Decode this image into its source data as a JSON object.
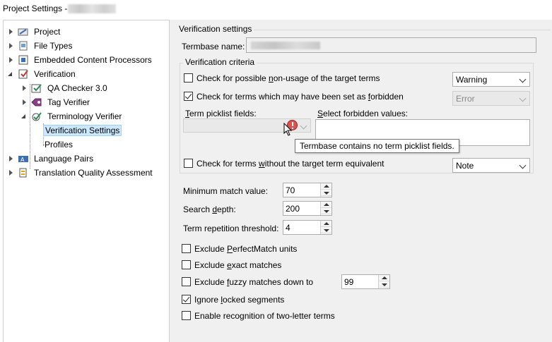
{
  "window": {
    "title": "Project Settings - "
  },
  "tree": {
    "items": [
      {
        "label": "Project"
      },
      {
        "label": "File Types"
      },
      {
        "label": "Embedded Content Processors"
      },
      {
        "label": "Verification"
      },
      {
        "label": "QA Checker 3.0"
      },
      {
        "label": "Tag Verifier"
      },
      {
        "label": "Terminology Verifier"
      },
      {
        "label": "Verification Settings"
      },
      {
        "label": "Profiles"
      },
      {
        "label": "Language Pairs"
      },
      {
        "label": "Translation Quality Assessment"
      }
    ]
  },
  "settings": {
    "section_title": "Verification settings",
    "termbase_label": "Termbase name:",
    "criteria": {
      "title": "Verification criteria",
      "nonusage": {
        "pre": "Check for possible ",
        "ul": "n",
        "post": "on-usage of the target terms",
        "checked": false,
        "severity": "Warning"
      },
      "forbidden": {
        "pre": "Check for terms which may have been set as ",
        "ul": "f",
        "post": "orbidden",
        "checked": true,
        "severity": "Error"
      },
      "picklist_label": {
        "pre": "",
        "ul": "T",
        "post": "erm picklist fields:"
      },
      "forbidden_values_label": {
        "pre": "",
        "ul": "S",
        "post": "elect forbidden values:"
      },
      "tooltip": "Termbase contains no term picklist fields.",
      "without": {
        "pre": "Check for terms ",
        "ul": "w",
        "post": "ithout the target term equivalent",
        "checked": false,
        "severity": "Note"
      }
    },
    "min_match": {
      "label": "Minimum match value:",
      "value": "70"
    },
    "search_depth": {
      "pre": "Search ",
      "ul": "d",
      "post": "epth:",
      "value": "200"
    },
    "repetition": {
      "label": "Term repetition threshold:",
      "value": "4"
    },
    "options": [
      {
        "pre": "Exclude ",
        "ul": "P",
        "post": "erfectMatch units",
        "checked": false
      },
      {
        "pre": "Exclude ",
        "ul": "e",
        "post": "xact matches",
        "checked": false
      },
      {
        "pre": "Exclude ",
        "ul": "f",
        "post": "uzzy matches down to",
        "checked": false,
        "value": "99"
      },
      {
        "pre": "Ignore ",
        "ul": "l",
        "post": "ocked segments",
        "checked": true
      },
      {
        "pre": "Enable recognition of two-letter terms",
        "ul": "",
        "post": "",
        "checked": false
      }
    ]
  },
  "colors": {
    "selection_bg": "#cce8ff",
    "selection_border": "#99d1ff",
    "error_icon": "#d9534f"
  }
}
